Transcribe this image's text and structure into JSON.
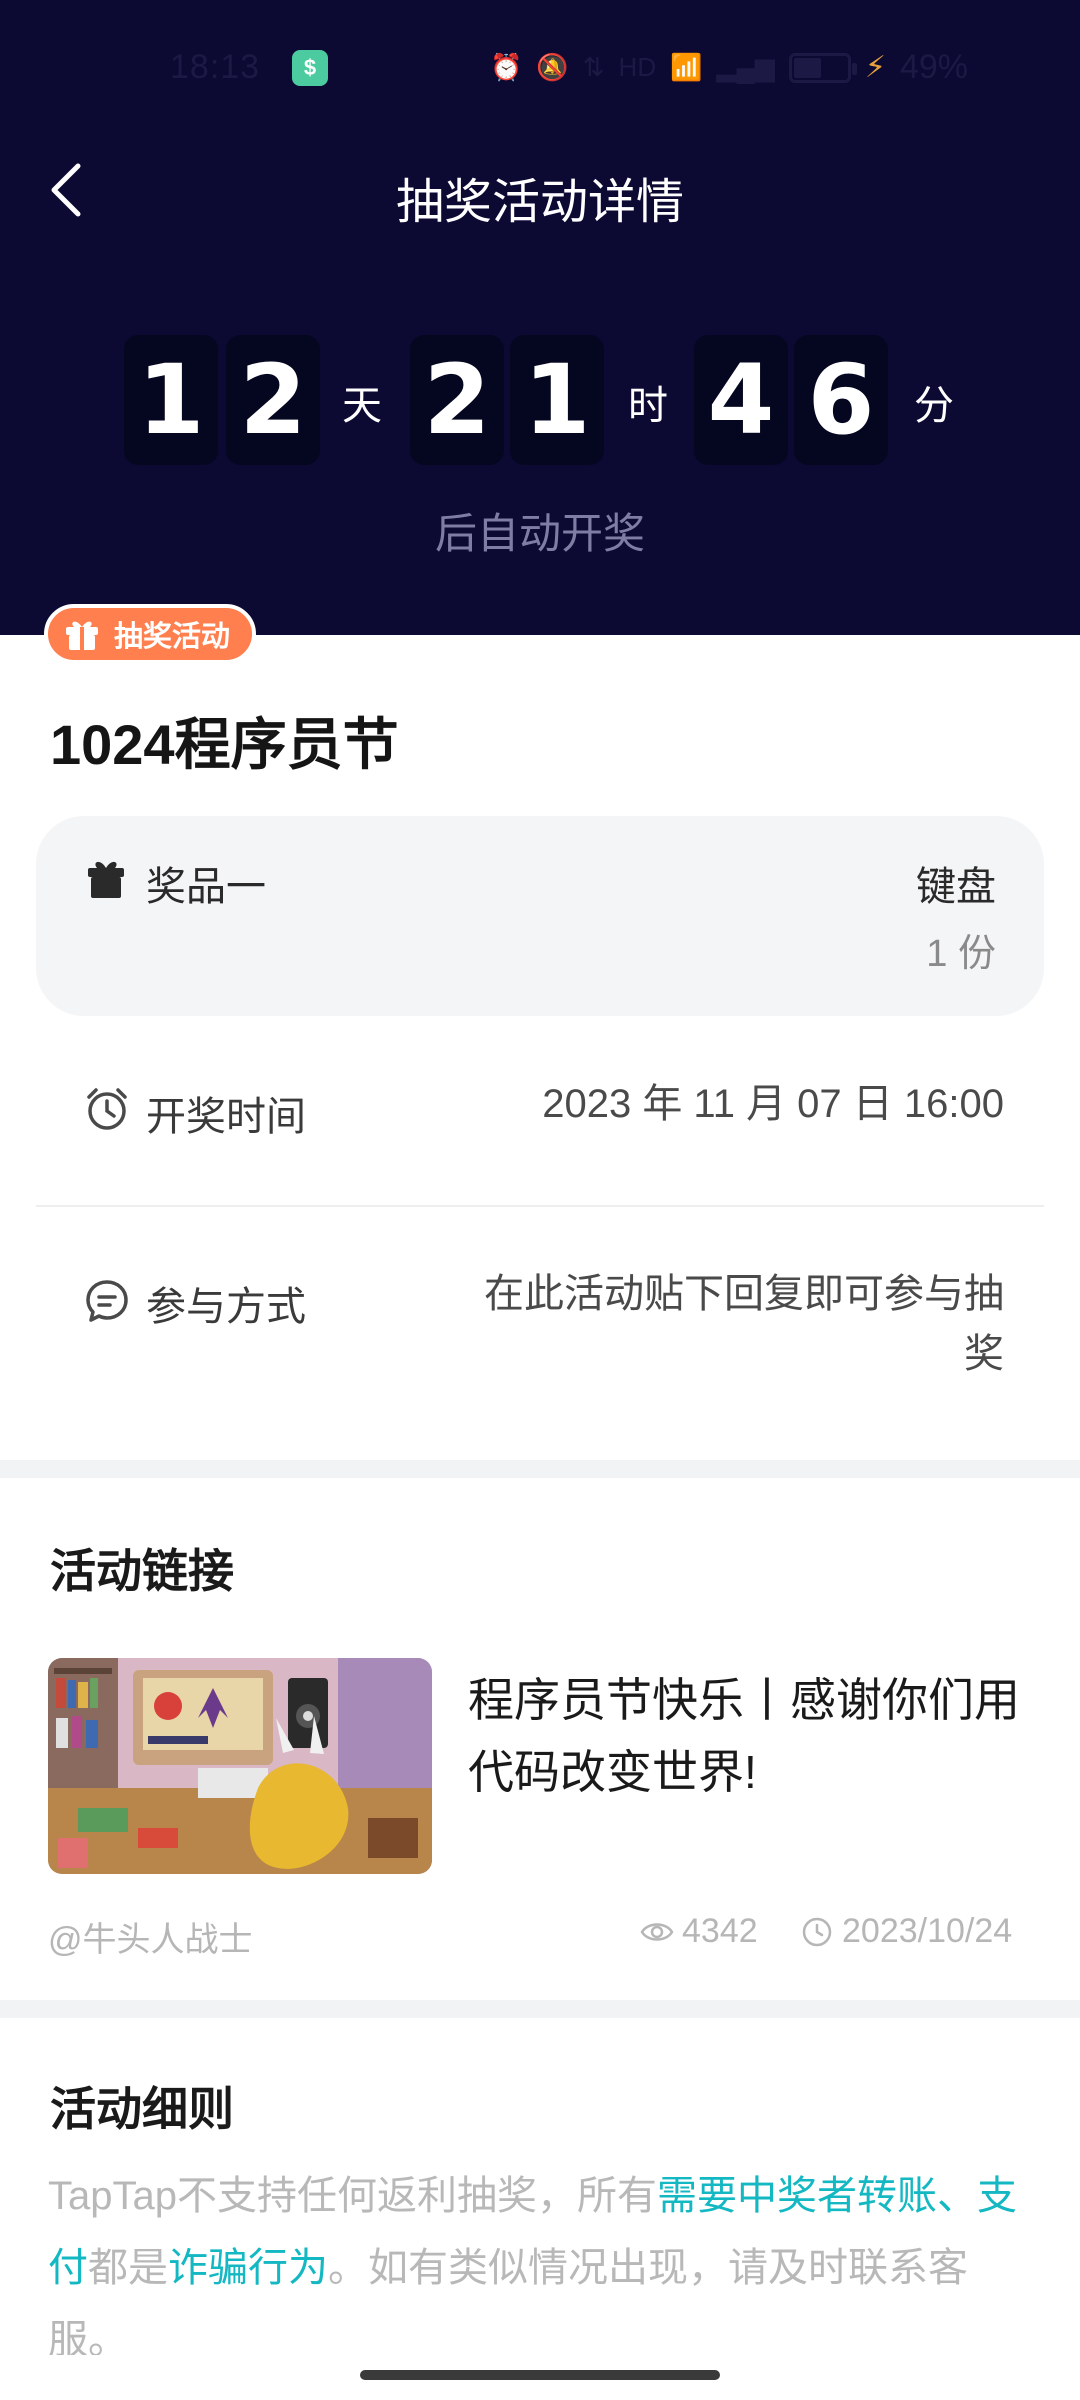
{
  "status_bar": {
    "time": "18:13",
    "battery": "49%",
    "app_icon": "dollar-app-icon"
  },
  "nav": {
    "title": "抽奖活动详情",
    "back_icon": "chevron-left-icon"
  },
  "countdown": {
    "days": [
      "1",
      "2"
    ],
    "day_unit": "天",
    "hours": [
      "2",
      "1"
    ],
    "hour_unit": "时",
    "minutes": [
      "4",
      "6"
    ],
    "minute_unit": "分",
    "subtitle": "后自动开奖"
  },
  "event": {
    "tag_label": "抽奖活动",
    "tag_icon": "gift-icon",
    "title": "1024程序员节"
  },
  "prize": {
    "label": "奖品一",
    "name": "键盘",
    "quantity": "1 份",
    "icon": "gift-icon"
  },
  "draw_time": {
    "label": "开奖时间",
    "value": "2023 年 11 月 07 日 16:00",
    "icon": "alarm-clock-icon"
  },
  "participation": {
    "label": "参与方式",
    "value_line1": "在此活动贴下回复即可参与抽",
    "value_line2": "奖",
    "icon": "chat-bubble-icon"
  },
  "link_section": {
    "title": "活动链接",
    "post_title": "程序员节快乐丨感谢你们用代码改变世界!",
    "author": "@牛头人战士",
    "views": "4342",
    "date": "2023/10/24"
  },
  "rules_section": {
    "title": "活动细则",
    "text_part1": "TapTap不支持任何返利抽奖，所有",
    "highlight1": "需要中奖者转账、支付",
    "text_part2": "都是",
    "highlight2": "诈骗行为",
    "text_part3": "。如有类似情况出现，请及时联系客服。"
  },
  "colors": {
    "header_bg": "#0c0933",
    "tag_orange": "#ff7f4f",
    "link_teal": "#14b8c2"
  }
}
